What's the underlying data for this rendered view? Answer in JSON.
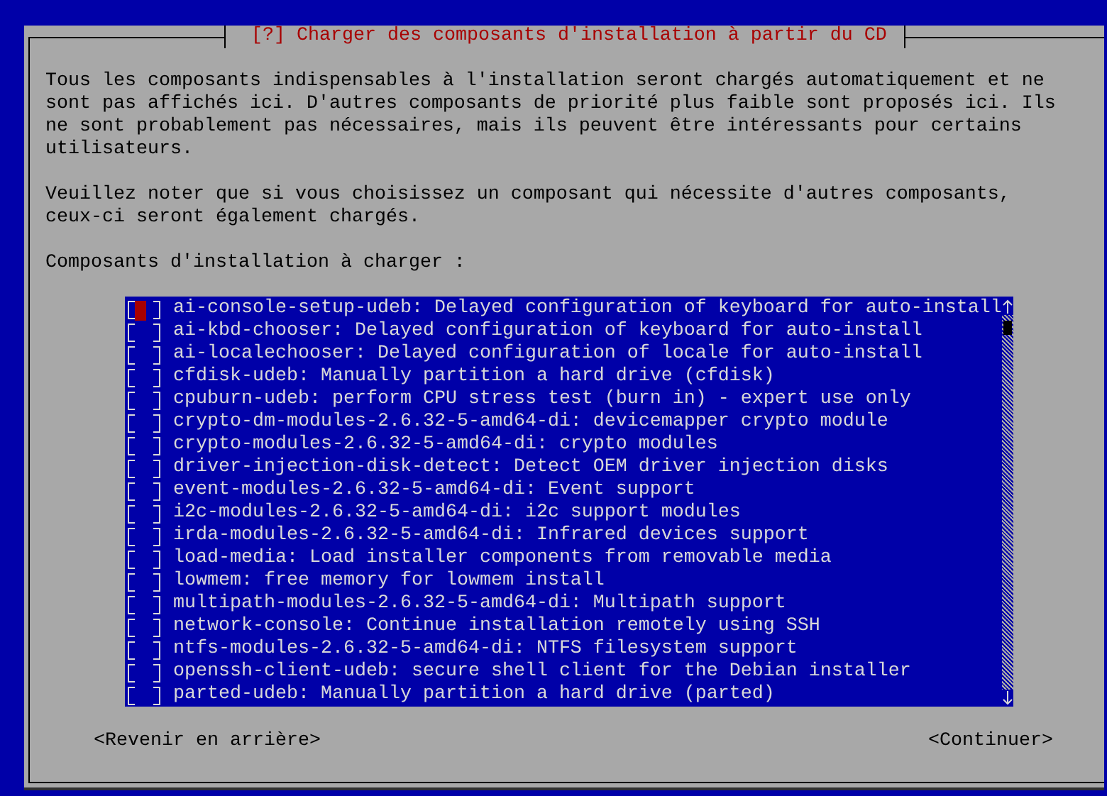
{
  "dialog": {
    "title": "[?] Charger des composants d'installation à partir du CD",
    "paragraphs": [
      "Tous les composants indispensables à l'installation seront chargés automatiquement et ne sont pas affichés ici. D'autres composants de priorité plus faible sont proposés ici. Ils ne sont probablement pas nécessaires, mais ils peuvent être intéressants pour certains utilisateurs.",
      "Veuillez noter que si vous choisissez un composant qui nécessite d'autres composants, ceux-ci seront également chargés."
    ],
    "list_label": "Composants d'installation à charger :",
    "items": [
      {
        "label": "ai-console-setup-udeb: Delayed configuration of keyboard for auto-install",
        "checked": false,
        "focused": true
      },
      {
        "label": "ai-kbd-chooser: Delayed configuration of keyboard for auto-install",
        "checked": false,
        "focused": false
      },
      {
        "label": "ai-localechooser: Delayed configuration of locale for auto-install",
        "checked": false,
        "focused": false
      },
      {
        "label": "cfdisk-udeb: Manually partition a hard drive (cfdisk)",
        "checked": false,
        "focused": false
      },
      {
        "label": "cpuburn-udeb: perform CPU stress test (burn in) - expert use only",
        "checked": false,
        "focused": false
      },
      {
        "label": "crypto-dm-modules-2.6.32-5-amd64-di: devicemapper crypto module",
        "checked": false,
        "focused": false
      },
      {
        "label": "crypto-modules-2.6.32-5-amd64-di: crypto modules",
        "checked": false,
        "focused": false
      },
      {
        "label": "driver-injection-disk-detect: Detect OEM driver injection disks",
        "checked": false,
        "focused": false
      },
      {
        "label": "event-modules-2.6.32-5-amd64-di: Event support",
        "checked": false,
        "focused": false
      },
      {
        "label": "i2c-modules-2.6.32-5-amd64-di: i2c support modules",
        "checked": false,
        "focused": false
      },
      {
        "label": "irda-modules-2.6.32-5-amd64-di: Infrared devices support",
        "checked": false,
        "focused": false
      },
      {
        "label": "load-media: Load installer components from removable media",
        "checked": false,
        "focused": false
      },
      {
        "label": "lowmem: free memory for lowmem install",
        "checked": false,
        "focused": false
      },
      {
        "label": "multipath-modules-2.6.32-5-amd64-di: Multipath support",
        "checked": false,
        "focused": false
      },
      {
        "label": "network-console: Continue installation remotely using SSH",
        "checked": false,
        "focused": false
      },
      {
        "label": "ntfs-modules-2.6.32-5-amd64-di: NTFS filesystem support",
        "checked": false,
        "focused": false
      },
      {
        "label": "openssh-client-udeb: secure shell client for the Debian installer",
        "checked": false,
        "focused": false
      },
      {
        "label": "parted-udeb: Manually partition a hard drive (parted)",
        "checked": false,
        "focused": false
      }
    ],
    "buttons": [
      "<Revenir en arrière>",
      "<Continuer>"
    ]
  }
}
